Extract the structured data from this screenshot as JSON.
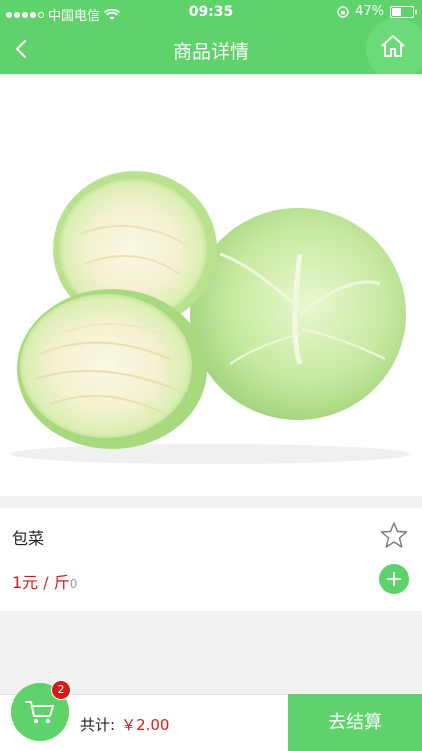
{
  "status_bar": {
    "carrier": "中国电信",
    "time": "09:35",
    "battery": "47%",
    "battery_level": 0.47,
    "signal_bars": 4
  },
  "nav": {
    "title": "商品详情",
    "back_icon": "chevron-left-icon",
    "home_icon": "home-icon"
  },
  "product": {
    "image": "cabbage-image",
    "name": "包菜",
    "price": "1元",
    "unit_sep": " / ",
    "unit": "斤",
    "qty": "0",
    "favorite_icon": "star-outline-icon",
    "add_icon": "plus-icon"
  },
  "cart": {
    "badge_count": "2",
    "total_label": "共计:",
    "total_amount": "￥2.00",
    "checkout_label": "去结算",
    "cart_icon": "shopping-cart-icon"
  },
  "colors": {
    "primary": "#5fd36b",
    "price": "#d61a1a",
    "background": "#f2f2f2"
  }
}
